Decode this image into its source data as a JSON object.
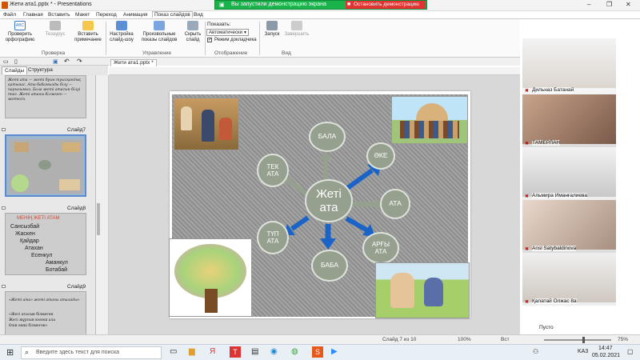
{
  "window": {
    "title": "Жети ата1.pptx * - Presentations"
  },
  "banner": {
    "message": "Вы запустили демонстрацию экрана",
    "stop_label": "Остановить демонстрацию"
  },
  "menu": {
    "items": [
      "Файл",
      "Главная",
      "Вставить",
      "Макет",
      "Переход",
      "Анимация",
      "Показ слайдов",
      "Вид"
    ],
    "active_index": 6
  },
  "ribbon": {
    "buttons": {
      "spellcheck": "Проверить орфографию",
      "thesaurus": "Тезаурус",
      "insert_comment": "Вставить примечание",
      "setup_show": "Настройка слайд-шоу",
      "custom_shows": "Произвольные показы слайдов",
      "hide_slide": "Скрыть слайд",
      "start": "Запуск",
      "finish": "Завершить"
    },
    "groups": {
      "review": "Проверка",
      "manage": "Управление",
      "display": "Отображение",
      "view": "Вид"
    },
    "show_label": "Показать:",
    "show_value": "Автоматически",
    "presenter_mode": "Режим докладчика"
  },
  "panel_tabs": {
    "slides": "Слайды",
    "outline": "Структура"
  },
  "doc_tab": "Жети ата1.pptx *",
  "thumbnails": {
    "slide7": "Слайд7",
    "slide8": "Слайд8",
    "slide9": "Слайд9",
    "slide6_text": "Жеті ата — жеті буын туысқандық қатынас. Ата-бабамызды білу — парызымыз. Бала жеті атасын білуі тиіс. Жеті атаны білмеген — жетесіз.",
    "slide8_title": "МЕНІҢ ЖЕТІ АТАМ",
    "slide8_lines": [
      "Сансызбай",
      "Жаскен",
      "Қайдар",
      "Атахан",
      "Есенкул",
      "Аманкул",
      "Ботабай"
    ],
    "slide9_title": "«Жеті ата» жеті атаны аталады»",
    "slide9_lines": [
      "«Жеті атасын білмеген",
      "Жеті жұртын көлеш ала",
      "Өзін ешкі білмеген»"
    ]
  },
  "diagram": {
    "center": "Жеті ата",
    "nodes": {
      "bala": "БАЛА",
      "ake": "ӘКЕ",
      "ata": "АТА",
      "argy_ata": "АРҒЫ АТА",
      "baba": "БАБА",
      "tup_ata": "ТҮП АТА",
      "tek_ata": "ТЕК АТА"
    }
  },
  "status": {
    "slide": "Слайд 7 из 10",
    "percent": "100%",
    "day": "Вст",
    "empty": "Пусто",
    "zoom": "75%"
  },
  "participants": [
    "Дильназ Батанай",
    "ТАМЕРЛАН",
    "Альмира Иманғалиева",
    "Ansl Satybaldinova",
    "Қалатай Олжас 8а"
  ],
  "taskbar": {
    "search_placeholder": "Введите здесь текст для поиска",
    "lang": "KA3",
    "time": "14:47",
    "date": "05.02.2021"
  }
}
